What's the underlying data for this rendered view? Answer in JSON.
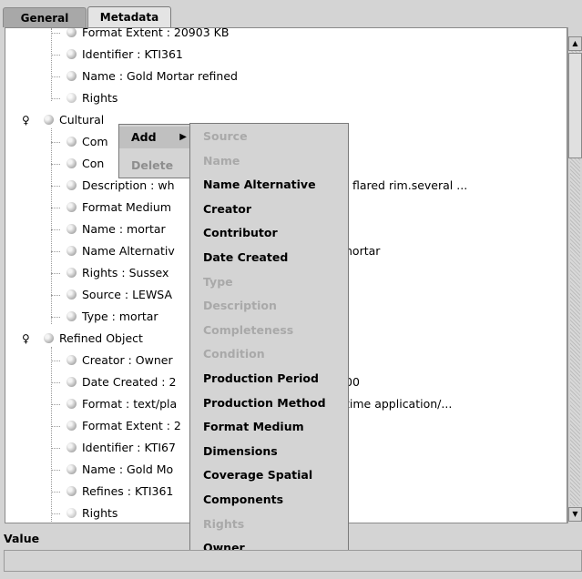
{
  "tabs": [
    {
      "label": "General",
      "active": false
    },
    {
      "label": "Metadata",
      "active": true
    }
  ],
  "tree_rows": [
    {
      "text": "Format Extent : 20903 KB",
      "level": 2
    },
    {
      "text": "Identifier : KTI361",
      "level": 2
    },
    {
      "text": "Name : Gold Mortar refined",
      "level": 2
    },
    {
      "text": "Rights",
      "level": 2,
      "faded": true
    },
    {
      "text": "Cultural",
      "level": 1,
      "expanded": true
    },
    {
      "text": "Com",
      "level": 2
    },
    {
      "text": "Con",
      "level": 2
    },
    {
      "text": "Description : wh",
      "level": 2,
      "tail": ", flared rim.several ..."
    },
    {
      "text": "Format Medium",
      "level": 2
    },
    {
      "text": "Name : mortar",
      "level": 2
    },
    {
      "text": "Name Alternativ",
      "level": 2,
      "tail": "nortar"
    },
    {
      "text": "Rights : Sussex",
      "level": 2
    },
    {
      "text": "Source : LEWSA",
      "level": 2
    },
    {
      "text": "Type : mortar",
      "level": 2
    },
    {
      "text": "Refined Object",
      "level": 1,
      "expanded": true
    },
    {
      "text": "Creator : Owner",
      "level": 2
    },
    {
      "text": "Date Created : 2",
      "level": 2,
      "tail": "00"
    },
    {
      "text": "Format : text/pla",
      "level": 2,
      "tail": "time application/..."
    },
    {
      "text": "Format Extent : 2",
      "level": 2
    },
    {
      "text": "Identifier : KTI67",
      "level": 2
    },
    {
      "text": "Name : Gold Mo",
      "level": 2
    },
    {
      "text": "Refines : KTI361",
      "level": 2
    },
    {
      "text": "Rights",
      "level": 2,
      "faded": true
    }
  ],
  "context_menu": {
    "add_label": "Add",
    "delete_label": "Delete",
    "submenu_arrow": "▶"
  },
  "submenu_items": [
    {
      "label": "Source",
      "enabled": false
    },
    {
      "label": "Name",
      "enabled": false
    },
    {
      "label": "Name Alternative",
      "enabled": true
    },
    {
      "label": "Creator",
      "enabled": true
    },
    {
      "label": "Contributor",
      "enabled": true
    },
    {
      "label": "Date Created",
      "enabled": true
    },
    {
      "label": "Type",
      "enabled": false
    },
    {
      "label": "Description",
      "enabled": false
    },
    {
      "label": "Completeness",
      "enabled": false
    },
    {
      "label": "Condition",
      "enabled": false
    },
    {
      "label": "Production Period",
      "enabled": true
    },
    {
      "label": "Production Method",
      "enabled": true
    },
    {
      "label": "Format Medium",
      "enabled": true
    },
    {
      "label": "Dimensions",
      "enabled": true
    },
    {
      "label": "Coverage Spatial",
      "enabled": true
    },
    {
      "label": "Components",
      "enabled": true
    },
    {
      "label": "Rights",
      "enabled": false
    },
    {
      "label": "Owner",
      "enabled": true
    }
  ],
  "value_panel": {
    "label": "Value",
    "value": ""
  },
  "scrollbar": {
    "up_glyph": "▲",
    "down_glyph": "▼"
  },
  "icons": {
    "node_icon": "metadata-node-icon",
    "expand_toggle": "tree-pin-icon"
  }
}
